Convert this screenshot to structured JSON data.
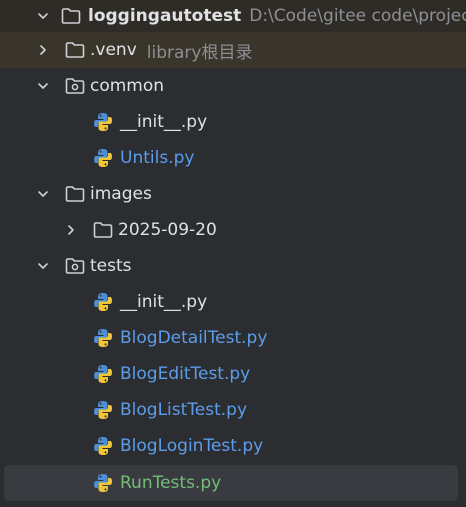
{
  "colors": {
    "background": "#2B2D30",
    "text": "#DFE1E5",
    "file_blue": "#5C9DEB",
    "file_green": "#73BD79",
    "hint_gray": "#8C8F95",
    "selection": "#393B40"
  },
  "icons": {
    "folder": "folder-icon",
    "package": "package-folder-icon",
    "python": "python-file-icon",
    "expand": "chevron-down-icon",
    "collapse": "chevron-right-icon"
  },
  "tree": {
    "root": {
      "name": "loggingautotest",
      "path": "D:\\Code\\gitee code\\project\\l"
    },
    "venv": {
      "name": ".venv",
      "hint": "library根目录"
    },
    "common": {
      "name": "common",
      "files": [
        "__init__.py",
        "Untils.py"
      ]
    },
    "images": {
      "name": "images",
      "subfolder": "2025-09-20"
    },
    "tests": {
      "name": "tests",
      "files": [
        "__init__.py",
        "BlogDetailTest.py",
        "BlogEditTest.py",
        "BlogListTest.py",
        "BlogLoginTest.py",
        "RunTests.py"
      ]
    }
  }
}
